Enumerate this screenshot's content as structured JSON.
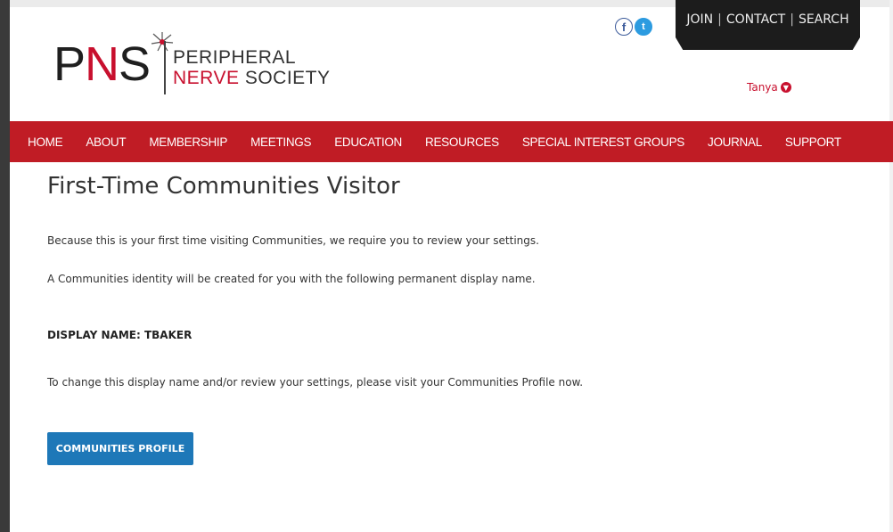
{
  "logo": {
    "letters": [
      "P",
      "N",
      "S"
    ],
    "line1": "PERIPHERAL",
    "line2_red": "NERVE",
    "line2_dark": "SOCIETY"
  },
  "social": {
    "facebook_glyph": "f",
    "twitter_glyph": "t"
  },
  "ribbon": {
    "links": [
      "JOIN",
      "CONTACT",
      "SEARCH"
    ],
    "separator": "|"
  },
  "user": {
    "name": "Tanya",
    "icon": "chevron-down-icon"
  },
  "nav": {
    "items": [
      "HOME",
      "ABOUT",
      "MEMBERSHIP",
      "MEETINGS",
      "EDUCATION",
      "RESOURCES",
      "SPECIAL INTEREST GROUPS",
      "JOURNAL",
      "SUPPORT"
    ]
  },
  "content": {
    "title": "First-Time Communities Visitor",
    "p1": "Because this is your first time visiting Communities, we require you to review your settings.",
    "p2": "A Communities identity will be created for you with the following permanent display name.",
    "display_name": "DISPLAY NAME: TBAKER",
    "p3": "To change this display name and/or review your settings, please visit your Communities Profile now.",
    "button_label": "COMMUNITIES PROFILE"
  },
  "colors": {
    "brand_red": "#c01c25",
    "button_blue": "#1e78b8",
    "ribbon_black": "#1c1c1c"
  }
}
